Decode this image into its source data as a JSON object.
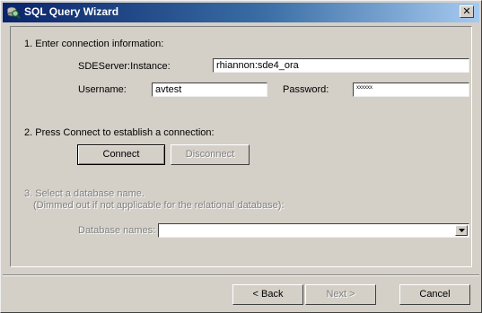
{
  "window": {
    "title": "SQL Query Wizard",
    "title_icon": "magnifier-db-icon",
    "close_glyph": "✕"
  },
  "step1": {
    "heading": "1. Enter connection information:",
    "server_label": "SDEServer:Instance:",
    "server_value": "rhiannon:sde4_ora",
    "username_label": "Username:",
    "username_value": "avtest",
    "password_label": "Password:",
    "password_value": "xxxxxx"
  },
  "step2": {
    "heading": "2. Press Connect to establish a connection:",
    "connect_label": "Connect",
    "disconnect_label": "Disconnect"
  },
  "step3": {
    "heading": "3. Select a database name.",
    "subheading": "(Dimmed out if not applicable for the relational database):",
    "db_label": "Database names:",
    "db_value": ""
  },
  "footer": {
    "back_label": "< Back",
    "next_label": "Next >",
    "cancel_label": "Cancel"
  }
}
